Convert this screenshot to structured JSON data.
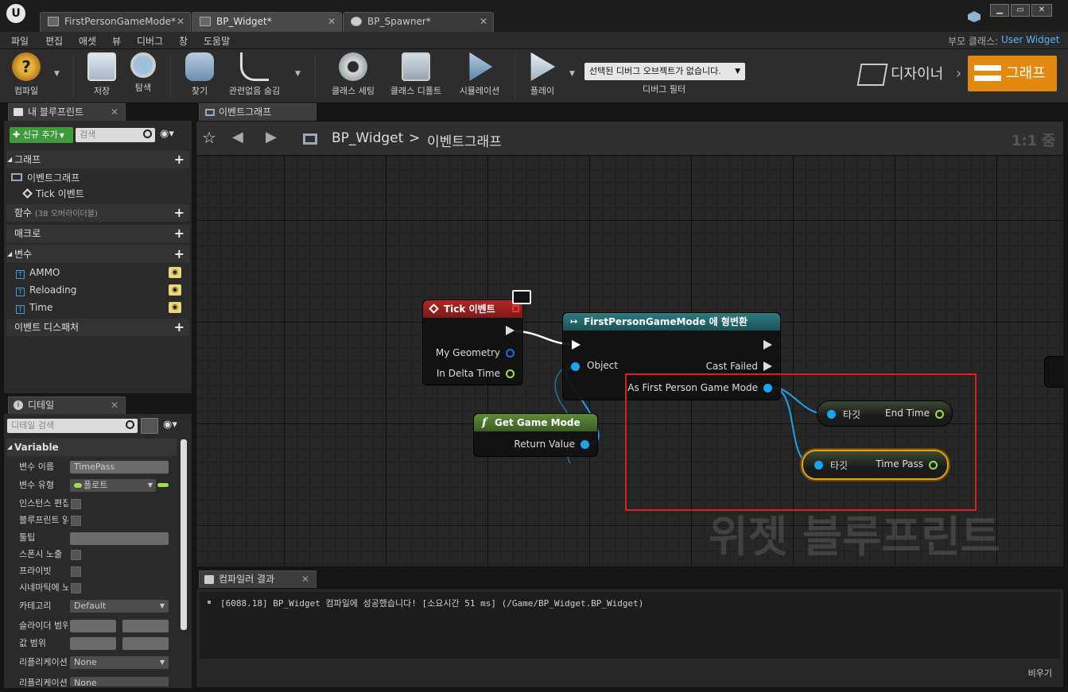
{
  "tabs": [
    {
      "label": "FirstPersonGameMode*",
      "active": false
    },
    {
      "label": "BP_Widget*",
      "active": true
    },
    {
      "label": "BP_Spawner*",
      "active": false
    }
  ],
  "menu": [
    "파일",
    "편집",
    "애셋",
    "뷰",
    "디버그",
    "창",
    "도움말"
  ],
  "parent_class": {
    "label": "부모 클래스:",
    "value": "User Widget"
  },
  "toolbar": {
    "compile": "컴파일",
    "save": "저장",
    "browse": "탐색",
    "find": "찾기",
    "hide_unrelated": "관련없음 숨김",
    "class_settings": "클래스 세팅",
    "class_defaults": "클래스 디폴트",
    "simulation": "시뮬레이션",
    "play": "플레이",
    "debug_select": "선택된 디버그 오브젝트가 없습니다.",
    "debug_filter": "디버그 필터",
    "designer": "디자이너",
    "graph": "그래프"
  },
  "my_blueprint": {
    "tab": "내 블루프린트",
    "add_new": "신규 추가",
    "search_placeholder": "검색",
    "graphs": "그래프",
    "event_graph": "이벤트그래프",
    "tick_event": "Tick 이벤트",
    "functions": "함수",
    "functions_note": "(38 오버라이더블)",
    "macros": "매크로",
    "variables": "변수",
    "vars": [
      "AMMO",
      "Reloading",
      "Time"
    ],
    "event_dispatchers": "이벤트 디스패처"
  },
  "details": {
    "tab": "디테일",
    "search_placeholder": "디테일 검색",
    "section": "Variable",
    "var_name_label": "변수 이름",
    "var_name": "TimePass",
    "var_type_label": "변수 유형",
    "var_type": "플로트",
    "instance_editable": "인스턴스 편집",
    "blueprint_readonly": "블루프린트 읽",
    "tooltip": "툴팁",
    "expose_spawn": "스폰시 노출",
    "private": "프라이빗",
    "expose_cinematic": "시네마틱에 노",
    "category_label": "카테고리",
    "category": "Default",
    "slider_range": "슬라이더 범위",
    "value_range": "값 범위",
    "replication_label": "리플리케이션",
    "replication": "None",
    "replication2_label": "리플리케이션",
    "replication2": "None"
  },
  "graph": {
    "tab": "이벤트그래프",
    "crumb_root": "BP_Widget",
    "crumb_sep": ">",
    "crumb_leaf": "이벤트그래프",
    "zoom": "1:1 줌",
    "watermark": "위젯 블루프린트",
    "tick_node": {
      "title": "Tick 이벤트",
      "pins": [
        "My Geometry",
        "In Delta Time"
      ]
    },
    "cast_node": {
      "title": "FirstPersonGameMode 에 형변환",
      "object": "Object",
      "cast_failed": "Cast Failed",
      "as": "As First Person Game Mode"
    },
    "getgm_node": {
      "title": "Get Game Mode",
      "ret": "Return Value"
    },
    "end_time_node": {
      "target": "타깃",
      "out": "End Time"
    },
    "time_pass_node": {
      "target": "타깃",
      "out": "Time Pass"
    }
  },
  "compiler": {
    "tab": "컴파일러 결과",
    "message": "[6088.18] BP_Widget 컴파일에 성공했습니다! [소요시간 51 ms] (/Game/BP_Widget.BP_Widget)",
    "clear": "비우기"
  },
  "colors": {
    "accent": "#e3890f",
    "exec": "#ffffff",
    "object_pin": "#1aa5ee",
    "float_pin": "#9ee04a",
    "highlight": "#e01e1e"
  }
}
